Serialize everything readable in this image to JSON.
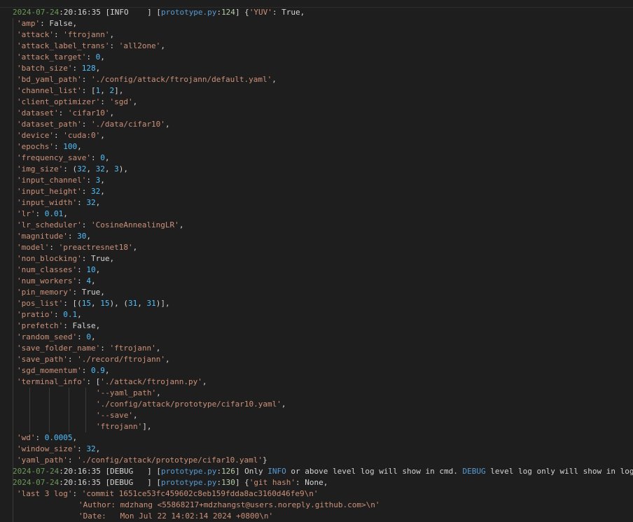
{
  "lines": [
    {
      "indent": 0,
      "segs": [
        [
          "ts-d",
          "2024-07-24"
        ],
        [
          "ts-t",
          ":20:16:35 "
        ],
        [
          "lvl",
          "[INFO    ] "
        ],
        [
          "kw",
          "["
        ],
        [
          "fl-f",
          "prototype.py"
        ],
        [
          "kw",
          ":"
        ],
        [
          "fl-n",
          "124"
        ],
        [
          "kw",
          "] {"
        ],
        [
          "key",
          "'YUV'"
        ],
        [
          "kw",
          ": True,"
        ]
      ]
    },
    {
      "indent": 6,
      "segs": [
        [
          "key",
          "'amp'"
        ],
        [
          "kw",
          ": False,"
        ]
      ]
    },
    {
      "indent": 6,
      "segs": [
        [
          "key",
          "'attack'"
        ],
        [
          "kw",
          ": "
        ],
        [
          "str",
          "'ftrojann'"
        ],
        [
          "kw",
          ","
        ]
      ]
    },
    {
      "indent": 6,
      "segs": [
        [
          "key",
          "'attack_label_trans'"
        ],
        [
          "kw",
          ": "
        ],
        [
          "str",
          "'all2one'"
        ],
        [
          "kw",
          ","
        ]
      ]
    },
    {
      "indent": 6,
      "segs": [
        [
          "key",
          "'attack_target'"
        ],
        [
          "kw",
          ": "
        ],
        [
          "num",
          "0"
        ],
        [
          "kw",
          ","
        ]
      ]
    },
    {
      "indent": 6,
      "segs": [
        [
          "key",
          "'batch_size'"
        ],
        [
          "kw",
          ": "
        ],
        [
          "num",
          "128"
        ],
        [
          "kw",
          ","
        ]
      ]
    },
    {
      "indent": 6,
      "segs": [
        [
          "key",
          "'bd_yaml_path'"
        ],
        [
          "kw",
          ": "
        ],
        [
          "str",
          "'./config/attack/ftrojann/default.yaml'"
        ],
        [
          "kw",
          ","
        ]
      ]
    },
    {
      "indent": 6,
      "segs": [
        [
          "key",
          "'channel_list'"
        ],
        [
          "kw",
          ": ["
        ],
        [
          "num",
          "1"
        ],
        [
          "kw",
          ", "
        ],
        [
          "num",
          "2"
        ],
        [
          "kw",
          "],"
        ]
      ]
    },
    {
      "indent": 6,
      "segs": [
        [
          "key",
          "'client_optimizer'"
        ],
        [
          "kw",
          ": "
        ],
        [
          "str",
          "'sgd'"
        ],
        [
          "kw",
          ","
        ]
      ]
    },
    {
      "indent": 6,
      "segs": [
        [
          "key",
          "'dataset'"
        ],
        [
          "kw",
          ": "
        ],
        [
          "str",
          "'cifar10'"
        ],
        [
          "kw",
          ","
        ]
      ]
    },
    {
      "indent": 6,
      "segs": [
        [
          "key",
          "'dataset_path'"
        ],
        [
          "kw",
          ": "
        ],
        [
          "str",
          "'./data/cifar10'"
        ],
        [
          "kw",
          ","
        ]
      ]
    },
    {
      "indent": 6,
      "segs": [
        [
          "key",
          "'device'"
        ],
        [
          "kw",
          ": "
        ],
        [
          "str",
          "'cuda:0'"
        ],
        [
          "kw",
          ","
        ]
      ]
    },
    {
      "indent": 6,
      "segs": [
        [
          "key",
          "'epochs'"
        ],
        [
          "kw",
          ": "
        ],
        [
          "num",
          "100"
        ],
        [
          "kw",
          ","
        ]
      ]
    },
    {
      "indent": 6,
      "segs": [
        [
          "key",
          "'frequency_save'"
        ],
        [
          "kw",
          ": "
        ],
        [
          "num",
          "0"
        ],
        [
          "kw",
          ","
        ]
      ]
    },
    {
      "indent": 6,
      "segs": [
        [
          "key",
          "'img_size'"
        ],
        [
          "kw",
          ": ("
        ],
        [
          "num",
          "32"
        ],
        [
          "kw",
          ", "
        ],
        [
          "num",
          "32"
        ],
        [
          "kw",
          ", "
        ],
        [
          "num",
          "3"
        ],
        [
          "kw",
          "),"
        ]
      ]
    },
    {
      "indent": 6,
      "segs": [
        [
          "key",
          "'input_channel'"
        ],
        [
          "kw",
          ": "
        ],
        [
          "num",
          "3"
        ],
        [
          "kw",
          ","
        ]
      ]
    },
    {
      "indent": 6,
      "segs": [
        [
          "key",
          "'input_height'"
        ],
        [
          "kw",
          ": "
        ],
        [
          "num",
          "32"
        ],
        [
          "kw",
          ","
        ]
      ]
    },
    {
      "indent": 6,
      "segs": [
        [
          "key",
          "'input_width'"
        ],
        [
          "kw",
          ": "
        ],
        [
          "num",
          "32"
        ],
        [
          "kw",
          ","
        ]
      ]
    },
    {
      "indent": 6,
      "segs": [
        [
          "key",
          "'lr'"
        ],
        [
          "kw",
          ": "
        ],
        [
          "num",
          "0.01"
        ],
        [
          "kw",
          ","
        ]
      ]
    },
    {
      "indent": 6,
      "segs": [
        [
          "key",
          "'lr_scheduler'"
        ],
        [
          "kw",
          ": "
        ],
        [
          "str",
          "'CosineAnnealingLR'"
        ],
        [
          "kw",
          ","
        ]
      ]
    },
    {
      "indent": 6,
      "segs": [
        [
          "key",
          "'magnitude'"
        ],
        [
          "kw",
          ": "
        ],
        [
          "num",
          "30"
        ],
        [
          "kw",
          ","
        ]
      ]
    },
    {
      "indent": 6,
      "segs": [
        [
          "key",
          "'model'"
        ],
        [
          "kw",
          ": "
        ],
        [
          "str",
          "'preactresnet18'"
        ],
        [
          "kw",
          ","
        ]
      ]
    },
    {
      "indent": 6,
      "segs": [
        [
          "key",
          "'non_blocking'"
        ],
        [
          "kw",
          ": True,"
        ]
      ]
    },
    {
      "indent": 6,
      "segs": [
        [
          "key",
          "'num_classes'"
        ],
        [
          "kw",
          ": "
        ],
        [
          "num",
          "10"
        ],
        [
          "kw",
          ","
        ]
      ]
    },
    {
      "indent": 6,
      "segs": [
        [
          "key",
          "'num_workers'"
        ],
        [
          "kw",
          ": "
        ],
        [
          "num",
          "4"
        ],
        [
          "kw",
          ","
        ]
      ]
    },
    {
      "indent": 6,
      "segs": [
        [
          "key",
          "'pin_memory'"
        ],
        [
          "kw",
          ": True,"
        ]
      ]
    },
    {
      "indent": 6,
      "segs": [
        [
          "key",
          "'pos_list'"
        ],
        [
          "kw",
          ": [("
        ],
        [
          "num",
          "15"
        ],
        [
          "kw",
          ", "
        ],
        [
          "num",
          "15"
        ],
        [
          "kw",
          "), ("
        ],
        [
          "num",
          "31"
        ],
        [
          "kw",
          ", "
        ],
        [
          "num",
          "31"
        ],
        [
          "kw",
          ")],"
        ]
      ]
    },
    {
      "indent": 6,
      "segs": [
        [
          "key",
          "'pratio'"
        ],
        [
          "kw",
          ": "
        ],
        [
          "num",
          "0.1"
        ],
        [
          "kw",
          ","
        ]
      ]
    },
    {
      "indent": 6,
      "segs": [
        [
          "key",
          "'prefetch'"
        ],
        [
          "kw",
          ": False,"
        ]
      ]
    },
    {
      "indent": 6,
      "segs": [
        [
          "key",
          "'random_seed'"
        ],
        [
          "kw",
          ": "
        ],
        [
          "num",
          "0"
        ],
        [
          "kw",
          ","
        ]
      ]
    },
    {
      "indent": 6,
      "segs": [
        [
          "key",
          "'save_folder_name'"
        ],
        [
          "kw",
          ": "
        ],
        [
          "str",
          "'ftrojann'"
        ],
        [
          "kw",
          ","
        ]
      ]
    },
    {
      "indent": 6,
      "segs": [
        [
          "key",
          "'save_path'"
        ],
        [
          "kw",
          ": "
        ],
        [
          "str",
          "'./record/ftrojann'"
        ],
        [
          "kw",
          ","
        ]
      ]
    },
    {
      "indent": 6,
      "segs": [
        [
          "key",
          "'sgd_momentum'"
        ],
        [
          "kw",
          ": "
        ],
        [
          "num",
          "0.9"
        ],
        [
          "kw",
          ","
        ]
      ]
    },
    {
      "indent": 6,
      "segs": [
        [
          "key",
          "'terminal_info'"
        ],
        [
          "kw",
          ": ["
        ],
        [
          "str",
          "'./attack/ftrojann.py'"
        ],
        [
          "kw",
          ","
        ]
      ]
    },
    {
      "indent": 119,
      "segs": [
        [
          "str",
          "'--yaml_path'"
        ],
        [
          "kw",
          ","
        ]
      ]
    },
    {
      "indent": 119,
      "segs": [
        [
          "str",
          "'./config/attack/prototype/cifar10.yaml'"
        ],
        [
          "kw",
          ","
        ]
      ]
    },
    {
      "indent": 119,
      "segs": [
        [
          "str",
          "'--save'"
        ],
        [
          "kw",
          ","
        ]
      ]
    },
    {
      "indent": 119,
      "segs": [
        [
          "str",
          "'ftrojann'"
        ],
        [
          "kw",
          "],"
        ]
      ]
    },
    {
      "indent": 6,
      "segs": [
        [
          "key",
          "'wd'"
        ],
        [
          "kw",
          ": "
        ],
        [
          "num",
          "0.0005"
        ],
        [
          "kw",
          ","
        ]
      ]
    },
    {
      "indent": 6,
      "segs": [
        [
          "key",
          "'window_size'"
        ],
        [
          "kw",
          ": "
        ],
        [
          "num",
          "32"
        ],
        [
          "kw",
          ","
        ]
      ]
    },
    {
      "indent": 6,
      "segs": [
        [
          "key",
          "'yaml_path'"
        ],
        [
          "kw",
          ": "
        ],
        [
          "str",
          "'./config/attack/prototype/cifar10.yaml'"
        ],
        [
          "kw",
          "}"
        ]
      ]
    },
    {
      "indent": 0,
      "segs": [
        [
          "ts-d",
          "2024-07-24"
        ],
        [
          "ts-t",
          ":20:16:35 "
        ],
        [
          "lvl",
          "[DEBUG   ] "
        ],
        [
          "kw",
          "["
        ],
        [
          "fl-f",
          "prototype.py"
        ],
        [
          "kw",
          ":"
        ],
        [
          "fl-n",
          "126"
        ],
        [
          "kw",
          "] Only "
        ],
        [
          "hl",
          "INFO"
        ],
        [
          "kw",
          " or above level log will show in cmd. "
        ],
        [
          "hl",
          "DEBUG"
        ],
        [
          "kw",
          " level log only will show in log file."
        ]
      ]
    },
    {
      "indent": 0,
      "segs": [
        [
          "ts-d",
          "2024-07-24"
        ],
        [
          "ts-t",
          ":20:16:35 "
        ],
        [
          "lvl",
          "[DEBUG   ] "
        ],
        [
          "kw",
          "["
        ],
        [
          "fl-f",
          "prototype.py"
        ],
        [
          "kw",
          ":"
        ],
        [
          "fl-n",
          "130"
        ],
        [
          "kw",
          "] {"
        ],
        [
          "key",
          "'git hash'"
        ],
        [
          "kw",
          ": None,"
        ]
      ]
    },
    {
      "indent": 6,
      "segs": [
        [
          "key",
          "'last 3 log'"
        ],
        [
          "kw",
          ": "
        ],
        [
          "str",
          "'commit 1651ce53fc459602c8eb159fdda8ac3160d46fe9\\n'"
        ]
      ]
    },
    {
      "indent": 94,
      "segs": [
        [
          "str",
          "'Author: mdzhang <55868217+mdzhangst@users.noreply.github.com>\\n'"
        ]
      ]
    },
    {
      "indent": 94,
      "segs": [
        [
          "str",
          "'Date:   Mon Jul 22 14:02:14 2024 +0800\\n'"
        ]
      ]
    }
  ]
}
